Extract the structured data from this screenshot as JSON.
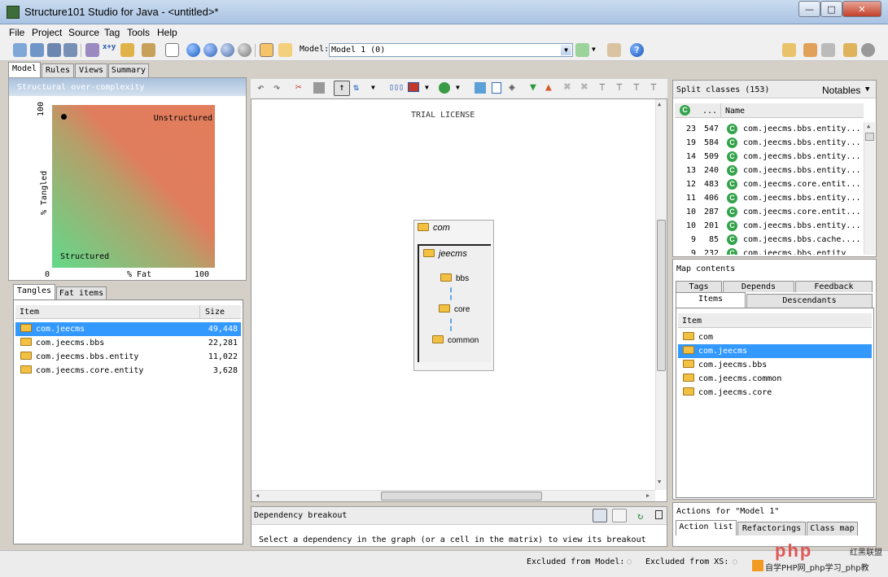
{
  "window": {
    "title": "Structure101 Studio for Java - <untitled>*"
  },
  "menu": [
    "File",
    "Project",
    "Source",
    "Tag",
    "Tools",
    "Help"
  ],
  "toolbar": {
    "model_label": "Model:",
    "model_value": "Model 1 (0)"
  },
  "left_tabs": [
    "Model",
    "Rules",
    "Views",
    "Summary"
  ],
  "complexity": {
    "title": "Structural over-complexity",
    "y_top": "100",
    "y_label": "% Tangled",
    "x_left": "0",
    "x_label": "% Fat",
    "x_right": "100",
    "label_unstructured": "Unstructured",
    "label_structured": "Structured",
    "point_tangled": 93,
    "point_fat": 7
  },
  "left_lower_tabs": [
    "Tangles",
    "Fat items"
  ],
  "tangles": {
    "col_item": "Item",
    "col_size": "Size",
    "rows": [
      {
        "item": "com.jeecms",
        "size": "49,448"
      },
      {
        "item": "com.jeecms.bbs",
        "size": "22,281"
      },
      {
        "item": "com.jeecms.bbs.entity",
        "size": "11,022"
      },
      {
        "item": "com.jeecms.core.entity",
        "size": "3,628"
      }
    ]
  },
  "graph": {
    "trial": "TRIAL LICENSE",
    "outer": "com",
    "inner": "jeecms",
    "nodes": [
      "bbs",
      "core",
      "common"
    ]
  },
  "dependency": {
    "title": "Dependency breakout",
    "message": "Select a dependency in the graph (or a cell in the matrix) to view its breakout"
  },
  "split": {
    "title": "Split classes (153)",
    "notables": "Notables",
    "col_dots": "...",
    "col_name": "Name",
    "rows": [
      {
        "a": "23",
        "b": "547",
        "name": "com.jeecms.bbs.entity..."
      },
      {
        "a": "19",
        "b": "584",
        "name": "com.jeecms.bbs.entity..."
      },
      {
        "a": "14",
        "b": "509",
        "name": "com.jeecms.bbs.entity..."
      },
      {
        "a": "13",
        "b": "240",
        "name": "com.jeecms.bbs.entity..."
      },
      {
        "a": "12",
        "b": "483",
        "name": "com.jeecms.core.entit..."
      },
      {
        "a": "11",
        "b": "406",
        "name": "com.jeecms.bbs.entity..."
      },
      {
        "a": "10",
        "b": "287",
        "name": "com.jeecms.core.entit..."
      },
      {
        "a": "10",
        "b": "201",
        "name": "com.jeecms.bbs.entity..."
      },
      {
        "a": "9",
        "b": "85",
        "name": "com.jeecms.bbs.cache...."
      },
      {
        "a": "9",
        "b": "232",
        "name": "com.jeecms.bbs.entity"
      }
    ]
  },
  "map": {
    "title": "Map contents",
    "tabs_top": [
      "Tags",
      "Depends",
      "Feedback"
    ],
    "tabs_bottom": [
      "Items",
      "Descendants"
    ],
    "col_item": "Item",
    "rows": [
      "com",
      "com.jeecms",
      "com.jeecms.bbs",
      "com.jeecms.common",
      "com.jeecms.core"
    ]
  },
  "actions": {
    "title": "Actions for \"Model 1\"",
    "tabs": [
      "Action list",
      "Refactorings",
      "Class map"
    ]
  },
  "status": {
    "excluded_model": "Excluded from Model:",
    "excluded_xs": "Excluded from XS:"
  },
  "watermark": {
    "logo": "php",
    "cn1": "红黑联盟",
    "cn2": "自学PHP网_php学习_php教"
  },
  "colors": {
    "selection": "#3399ff",
    "class_icon": "#33a34a",
    "folder": "#f3c142"
  }
}
